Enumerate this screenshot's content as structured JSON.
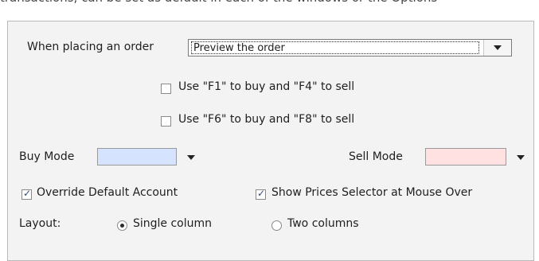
{
  "top_text": "transactions, can be set as default in each of the windows or the Options",
  "order": {
    "label": "When placing an order",
    "selected": "Preview the order"
  },
  "hotkeys": {
    "f1f4": "Use \"F1\" to buy and \"F4\" to sell",
    "f6f8": "Use \"F6\" to buy and \"F8\" to sell"
  },
  "modes": {
    "buy_label": "Buy Mode",
    "sell_label": "Sell Mode",
    "buy_color": "#d6e3ff",
    "sell_color": "#ffe1e1"
  },
  "options": {
    "override_account": "Override Default Account",
    "show_prices": "Show Prices Selector at Mouse Over",
    "override_checked": true,
    "show_prices_checked": true
  },
  "layout": {
    "label": "Layout:",
    "single": "Single column",
    "two": "Two columns",
    "selected": "Single column"
  },
  "icons": {
    "dropdown": "chevron-down-icon",
    "check": "checkmark-icon"
  }
}
